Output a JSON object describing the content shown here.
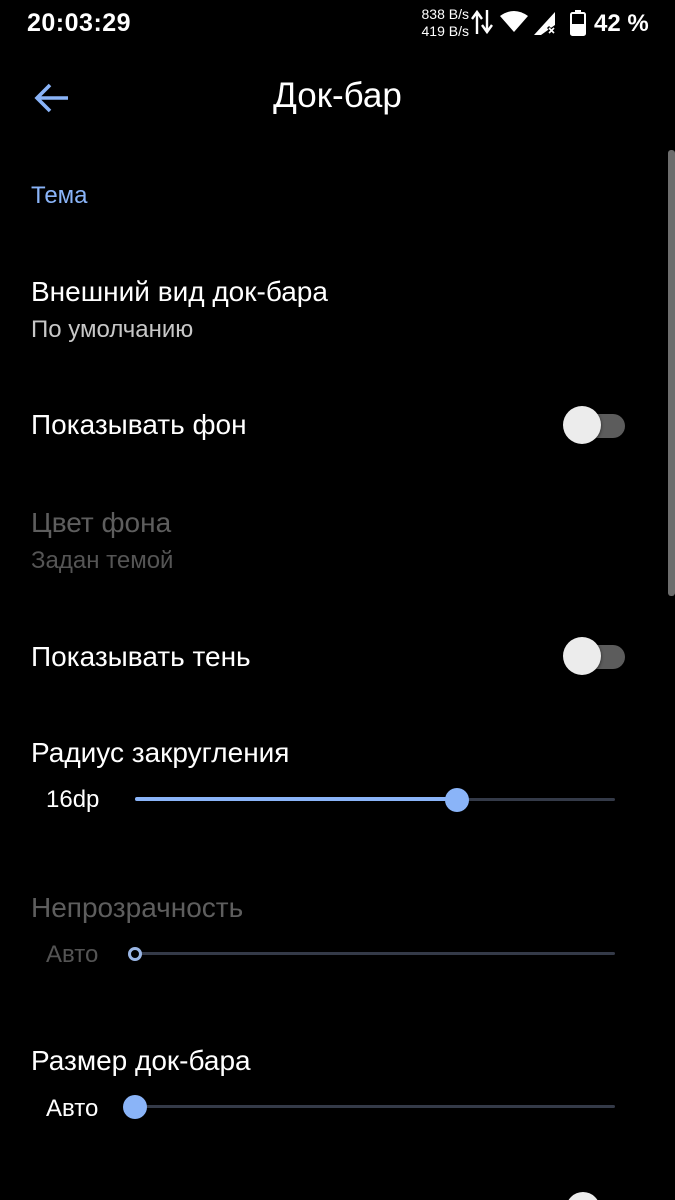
{
  "status_bar": {
    "time": "20:03:29",
    "upload_speed": "838 B/s",
    "download_speed": "419 B/s",
    "battery": "42 %",
    "icons": [
      "data-arrows-icon",
      "wifi-icon",
      "signal-icon",
      "battery-icon"
    ]
  },
  "toolbar": {
    "back_icon": "arrow-back-icon",
    "title": "Док-бар"
  },
  "colors": {
    "accent": "#8ab4f8",
    "background": "#000000",
    "text": "#ffffff",
    "disabled_text": "#5e5e5e"
  },
  "section": {
    "header": "Тема"
  },
  "prefs": {
    "appearance": {
      "title": "Внешний вид док-бара",
      "summary": "По умолчанию"
    },
    "show_background": {
      "title": "Показывать фон",
      "enabled": false
    },
    "background_color": {
      "title": "Цвет фона",
      "summary": "Задан темой",
      "disabled": true
    },
    "show_shadow": {
      "title": "Показывать тень",
      "enabled": false
    },
    "corner_radius": {
      "title": "Радиус закругления",
      "value": "16dp",
      "fraction": 0.67
    },
    "opacity": {
      "title": "Непрозрачность",
      "value": "Авто",
      "fraction": 0.0,
      "disabled": true
    },
    "dock_size": {
      "title": "Размер док-бара",
      "value": "Авто",
      "fraction": 0.0
    }
  }
}
